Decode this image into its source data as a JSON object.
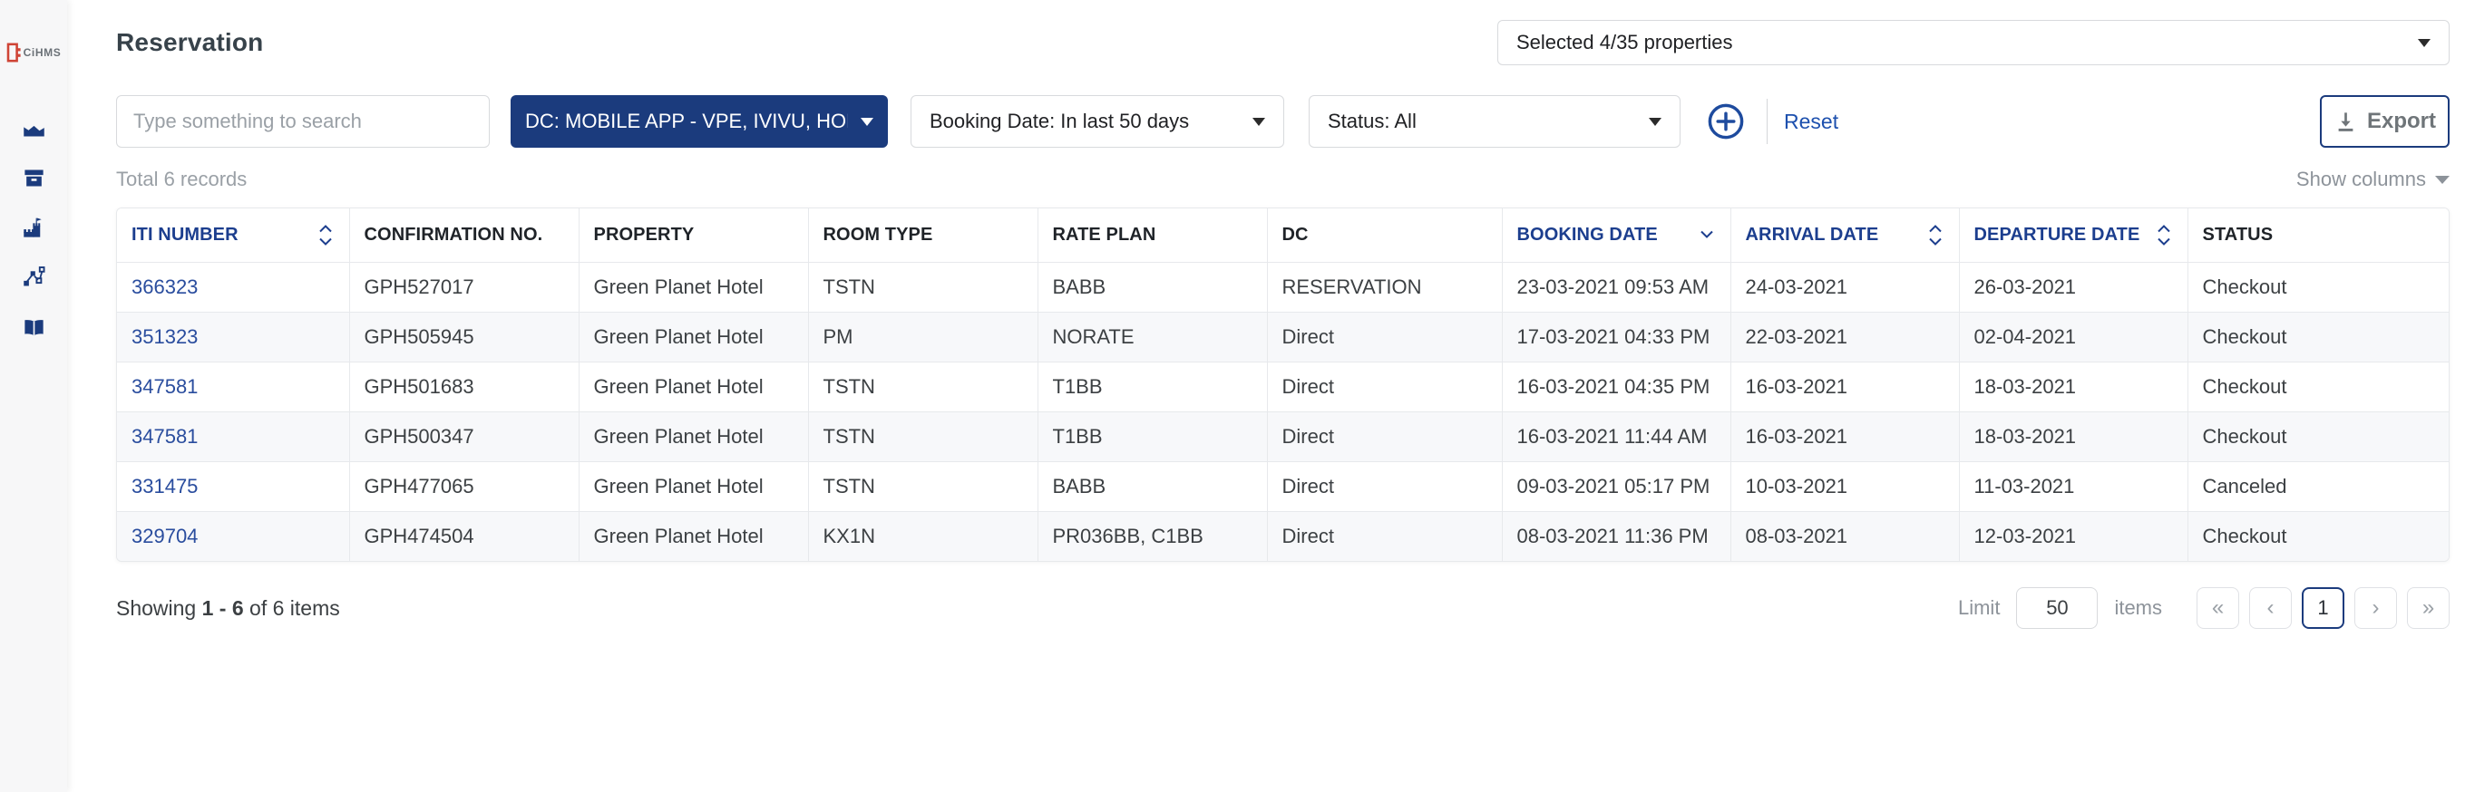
{
  "brand": {
    "logo_text": "CiHMS"
  },
  "sidebar": {
    "items": [
      {
        "id": "analytics",
        "icon": "area-chart-icon"
      },
      {
        "id": "inventory",
        "icon": "archive-box-icon"
      },
      {
        "id": "property",
        "icon": "castle-icon"
      },
      {
        "id": "channels",
        "icon": "route-chart-icon"
      },
      {
        "id": "reservations",
        "icon": "open-book-icon"
      }
    ]
  },
  "header": {
    "title": "Reservation",
    "property_selector": "Selected 4/35 properties"
  },
  "filters": {
    "search_placeholder": "Type something to search",
    "dc_filter": "DC: MOBILE APP - VPE, IVIVU, HON...",
    "booking_date_filter": "Booking Date: In last 50 days",
    "status_filter": "Status: All",
    "reset_label": "Reset",
    "export_label": "Export"
  },
  "meta": {
    "total_label": "Total 6 records",
    "show_columns_label": "Show columns"
  },
  "table": {
    "columns": [
      {
        "id": "iti-number",
        "label": "ITI NUMBER",
        "sort": "both"
      },
      {
        "id": "confirmation-no",
        "label": "CONFIRMATION NO.",
        "sort": "none"
      },
      {
        "id": "property",
        "label": "PROPERTY",
        "sort": "none"
      },
      {
        "id": "room-type",
        "label": "ROOM TYPE",
        "sort": "none"
      },
      {
        "id": "rate-plan",
        "label": "RATE PLAN",
        "sort": "none"
      },
      {
        "id": "dc",
        "label": "DC",
        "sort": "none"
      },
      {
        "id": "booking-date",
        "label": "BOOKING DATE",
        "sort": "desc"
      },
      {
        "id": "arrival-date",
        "label": "ARRIVAL DATE",
        "sort": "both"
      },
      {
        "id": "departure-date",
        "label": "DEPARTURE DATE",
        "sort": "both"
      },
      {
        "id": "status",
        "label": "STATUS",
        "sort": "none"
      }
    ],
    "rows": [
      [
        "366323",
        "GPH527017",
        "Green Planet Hotel",
        "TSTN",
        "BABB",
        "RESERVATION",
        "23-03-2021 09:53 AM",
        "24-03-2021",
        "26-03-2021",
        "Checkout"
      ],
      [
        "351323",
        "GPH505945",
        "Green Planet Hotel",
        "PM",
        "NORATE",
        "Direct",
        "17-03-2021 04:33 PM",
        "22-03-2021",
        "02-04-2021",
        "Checkout"
      ],
      [
        "347581",
        "GPH501683",
        "Green Planet Hotel",
        "TSTN",
        "T1BB",
        "Direct",
        "16-03-2021 04:35 PM",
        "16-03-2021",
        "18-03-2021",
        "Checkout"
      ],
      [
        "347581",
        "GPH500347",
        "Green Planet Hotel",
        "TSTN",
        "T1BB",
        "Direct",
        "16-03-2021 11:44 AM",
        "16-03-2021",
        "18-03-2021",
        "Checkout"
      ],
      [
        "331475",
        "GPH477065",
        "Green Planet Hotel",
        "TSTN",
        "BABB",
        "Direct",
        "09-03-2021 05:17 PM",
        "10-03-2021",
        "11-03-2021",
        "Canceled"
      ],
      [
        "329704",
        "GPH474504",
        "Green Planet Hotel",
        "KX1N",
        "PR036BB, C1BB",
        "Direct",
        "08-03-2021 11:36 PM",
        "08-03-2021",
        "12-03-2021",
        "Checkout"
      ]
    ]
  },
  "footer": {
    "showing_prefix": "Showing",
    "showing_range": "1 - 6",
    "showing_suffix": "of 6 items",
    "limit_label": "Limit",
    "limit_value": "50",
    "items_label": "items",
    "pagination": {
      "first": "«",
      "prev": "‹",
      "page": "1",
      "next": "›",
      "last": "»"
    }
  },
  "colors": {
    "brand_navy": "#1b3b7d",
    "header_sort_blue": "#1c3e8e",
    "link_blue": "#2a4d9e",
    "reset_blue": "#1d50ae",
    "sidebar_bg": "#f7f7f8",
    "zebra_row": "#f7f8fa",
    "status_checkout": "#3c4043"
  }
}
